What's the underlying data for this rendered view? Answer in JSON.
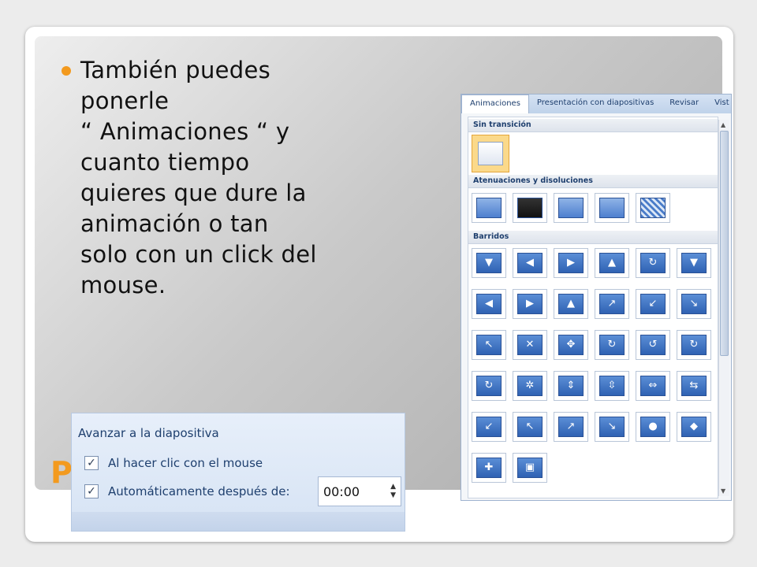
{
  "slide": {
    "body_text": "También puedes\nponerle\n“ Animaciones “ y\ncuanto tiempo\nquieres que dure la\nanimación o tan\nsolo con un click del\nmouse.",
    "title_fragment": "P",
    "accent_color": "#f39a1e"
  },
  "advance_panel": {
    "title": "Avanzar a la diapositiva",
    "option_click_label": "Al hacer clic con el mouse",
    "option_click_checked": true,
    "option_auto_label": "Automáticamente después de:",
    "option_auto_checked": true,
    "time_value": "00:00"
  },
  "gallery": {
    "tabs": [
      {
        "label": "Animaciones"
      },
      {
        "label": "Presentación con diapositivas"
      },
      {
        "label": "Revisar"
      },
      {
        "label": "Vist"
      }
    ],
    "sections": [
      {
        "label": "Sin transición"
      },
      {
        "label": "Atenuaciones y disoluciones"
      },
      {
        "label": "Barridos"
      }
    ]
  }
}
